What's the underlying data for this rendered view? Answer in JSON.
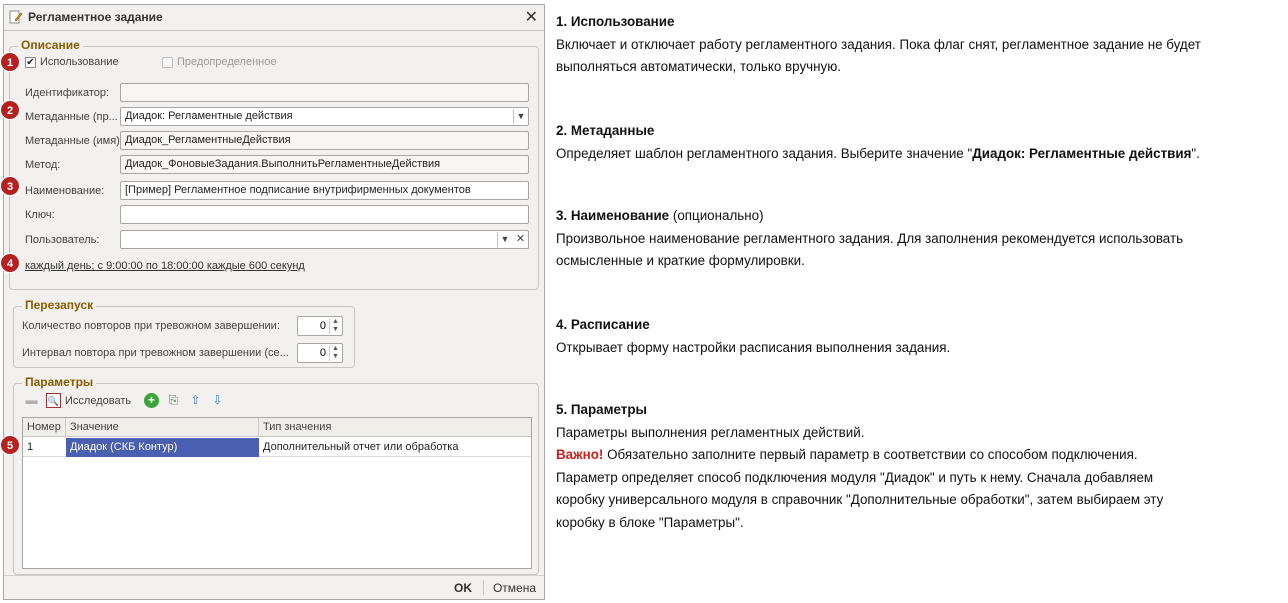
{
  "window": {
    "title": "Регламентное задание",
    "close_symbol": "✕",
    "ok_label": "OK",
    "cancel_label": "Отмена"
  },
  "description_group": {
    "title": "Описание",
    "use_label": "Использование",
    "use_checked": true,
    "predefined_label": "Предопределенное",
    "predefined_checked": false,
    "identifier_label": "Идентификатор:",
    "identifier_value": "",
    "metadata_label": "Метаданные (пр...",
    "metadata_value": "Диадок: Регламентные действия",
    "metadata_name_label": "Метаданные (имя):",
    "metadata_name_value": "Диадок_РегламентныеДействия",
    "method_label": "Метод:",
    "method_value": "Диадок_ФоновыеЗадания.ВыполнитьРегламентныеДействия",
    "name_label": "Наименование:",
    "name_value": "[Пример] Регламентное подписание внутрифирменных документов",
    "key_label": "Ключ:",
    "key_value": "",
    "user_label": "Пользователь:",
    "user_value": "",
    "schedule_link": "каждый день; с 9:00:00 по 18:00:00 каждые 600 секунд"
  },
  "restart_group": {
    "title": "Перезапуск",
    "retry_count_label": "Количество повторов при тревожном завершении:",
    "retry_count_value": "0",
    "retry_interval_label": "Интервал повтора при тревожном завершении (се...",
    "retry_interval_value": "0"
  },
  "params_group": {
    "title": "Параметры",
    "investigate_label": "Исследовать",
    "columns": [
      "Номер",
      "Значение",
      "Тип значения"
    ],
    "rows": [
      {
        "num": "1",
        "value": "Диадок (СКБ Контур)",
        "type": "Дополнительный отчет или обработка"
      }
    ]
  },
  "badges": [
    "1",
    "2",
    "3",
    "4",
    "5"
  ],
  "help": {
    "s1_title": "1. Использование",
    "s1_line1": "Включает и отключает работу регламентного задания. Пока флаг снят, регламентное задание не будет",
    "s1_line2": "выполняться автоматически, только вручную.",
    "s2_title": "2. Метаданные",
    "s2_pre": "Определяет шаблон регламентного задания. Выберите значение \"",
    "s2_bold": "Диадок: Регламентные действия",
    "s2_post": "\".",
    "s3_title": "3. Наименование",
    "s3_title_suffix": " (опционально)",
    "s3_line1": "Произвольное наименование регламентного задания. Для заполнения рекомендуется использовать",
    "s3_line2": "осмысленные и краткие формулировки.",
    "s4_title": "4. Расписание",
    "s4_line1": "Открывает форму настройки расписания выполнения задания.",
    "s5_title": "5. Параметры",
    "s5_line1": "Параметры выполнения регламентных действий.",
    "s5_warn": "Важно!",
    "s5_line2": " Обязательно заполните первый параметр в соответствии со способом подключения.",
    "s5_line3": "Параметр определяет способ подключения модуля \"Диадок\" и путь к нему. Сначала добавляем",
    "s5_line4": "коробку универсального модуля в справочник \"Дополнительные обработки\", затем выбираем эту",
    "s5_line5": "коробку в блоке \"Параметры\"."
  },
  "colors": {
    "badge": "#b52020",
    "group_title": "#8a5d00",
    "selected_cell": "#4b5fb0",
    "warning": "#cc1f1f"
  }
}
